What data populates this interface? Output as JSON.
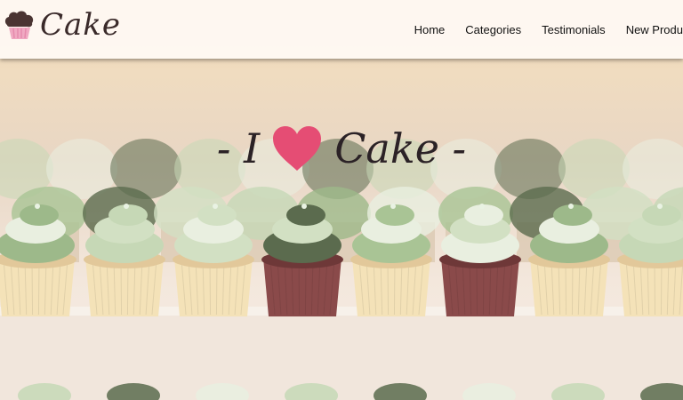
{
  "brand": {
    "name": "Cake",
    "logo_icon": "cupcake-icon"
  },
  "nav": {
    "items": [
      "Home",
      "Categories",
      "Testimonials",
      "New Produ"
    ]
  },
  "hero": {
    "prefix": "- I",
    "heart_icon": "heart-icon",
    "word": "Cake -",
    "heart_color": "#e54d74"
  },
  "colors": {
    "header_bg": "#fdf8f2",
    "text_dark": "#2b2226"
  }
}
